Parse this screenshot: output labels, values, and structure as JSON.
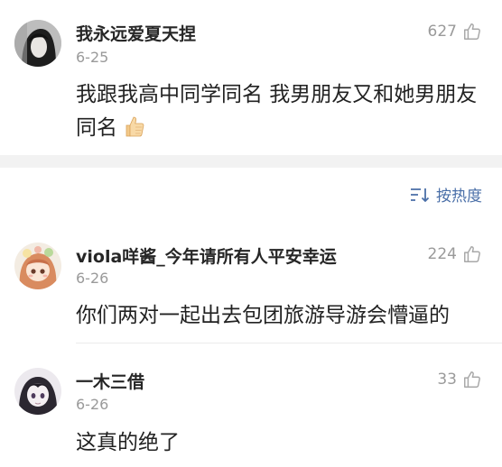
{
  "comments": [
    {
      "username": "我永远爱夏天捏",
      "date": "6-25",
      "likes": "627",
      "content": "我跟我高中同学同名 我男朋友又和她男朋友同名",
      "avatar_icon": "avatar-dark-hair-icon"
    },
    {
      "username": "viola咩酱_今年请所有人平安幸运",
      "date": "6-26",
      "likes": "224",
      "content": "你们两对一起出去包团旅游导游会懵逼的",
      "avatar_icon": "avatar-anime-girl-icon"
    },
    {
      "username": "一木三借",
      "date": "6-26",
      "likes": "33",
      "content": "这真的绝了",
      "avatar_icon": "avatar-anime-dark-icon"
    }
  ],
  "sort": {
    "label": "按热度",
    "icon": "sort-icon"
  },
  "colors": {
    "link_blue": "#4a6fa8",
    "meta_gray": "#9a9a9a",
    "section_bg": "#f2f2f2"
  }
}
